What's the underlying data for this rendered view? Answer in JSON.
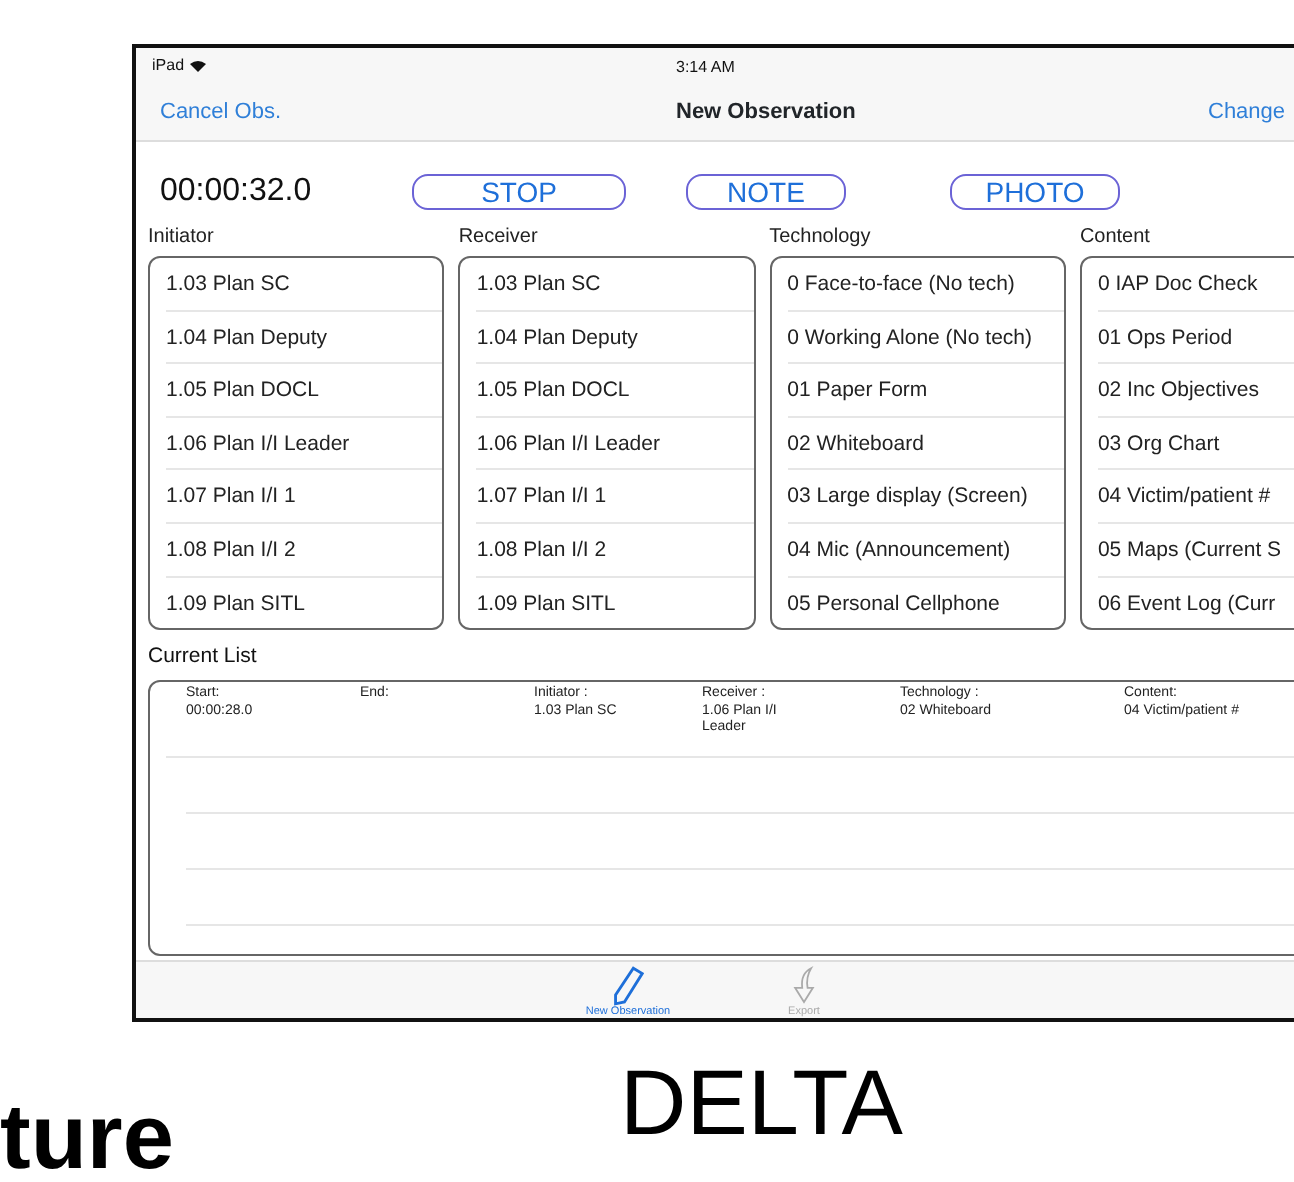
{
  "status_bar": {
    "device": "iPad",
    "time": "3:14 AM"
  },
  "nav": {
    "left": "Cancel Obs.",
    "title": "New Observation",
    "right": "Change"
  },
  "timer": "00:00:32.0",
  "buttons": [
    "STOP",
    "NOTE",
    "PHOTO"
  ],
  "pickers": [
    {
      "label": "Initiator",
      "items": [
        "1.03 Plan SC",
        "1.04 Plan Deputy",
        "1.05 Plan DOCL",
        "1.06 Plan I/I Leader",
        "1.07 Plan I/I 1",
        "1.08 Plan I/I 2",
        "1.09 Plan SITL"
      ]
    },
    {
      "label": "Receiver",
      "items": [
        "1.03 Plan SC",
        "1.04 Plan Deputy",
        "1.05 Plan DOCL",
        "1.06 Plan I/I Leader",
        "1.07 Plan I/I 1",
        "1.08 Plan I/I 2",
        "1.09 Plan SITL"
      ]
    },
    {
      "label": "Technology",
      "items": [
        "0 Face-to-face (No tech)",
        "0 Working Alone (No tech)",
        "01 Paper Form",
        "02 Whiteboard",
        "03 Large display (Screen)",
        "04 Mic (Announcement)",
        "05 Personal Cellphone"
      ]
    },
    {
      "label": "Content",
      "items": [
        "0 IAP Doc Check",
        "01 Ops Period",
        "02 Inc Objectives",
        "03 Org Chart",
        "04 Victim/patient #",
        "05 Maps (Current S",
        "06 Event Log (Curr"
      ]
    }
  ],
  "current_list": {
    "label": "Current List",
    "rows": [
      {
        "fields": [
          {
            "label": "Start:",
            "value": "00:00:28.0"
          },
          {
            "label": "End:"
          },
          {
            "label": "Initiator :",
            "value": "1.03 Plan SC"
          },
          {
            "label": "Receiver :",
            "value": "1.06 Plan I/I Leader"
          },
          {
            "label": "Technology :",
            "value": "02 Whiteboard"
          },
          {
            "label": "Content:",
            "value": "04 Victim/patient #"
          }
        ]
      }
    ]
  },
  "tab_bar": [
    {
      "kind": "pencil",
      "label": "New Observation",
      "selected": true
    },
    {
      "kind": "export",
      "label": "Export",
      "selected": false
    }
  ],
  "caption": "DELTA",
  "side_text": "ture"
}
